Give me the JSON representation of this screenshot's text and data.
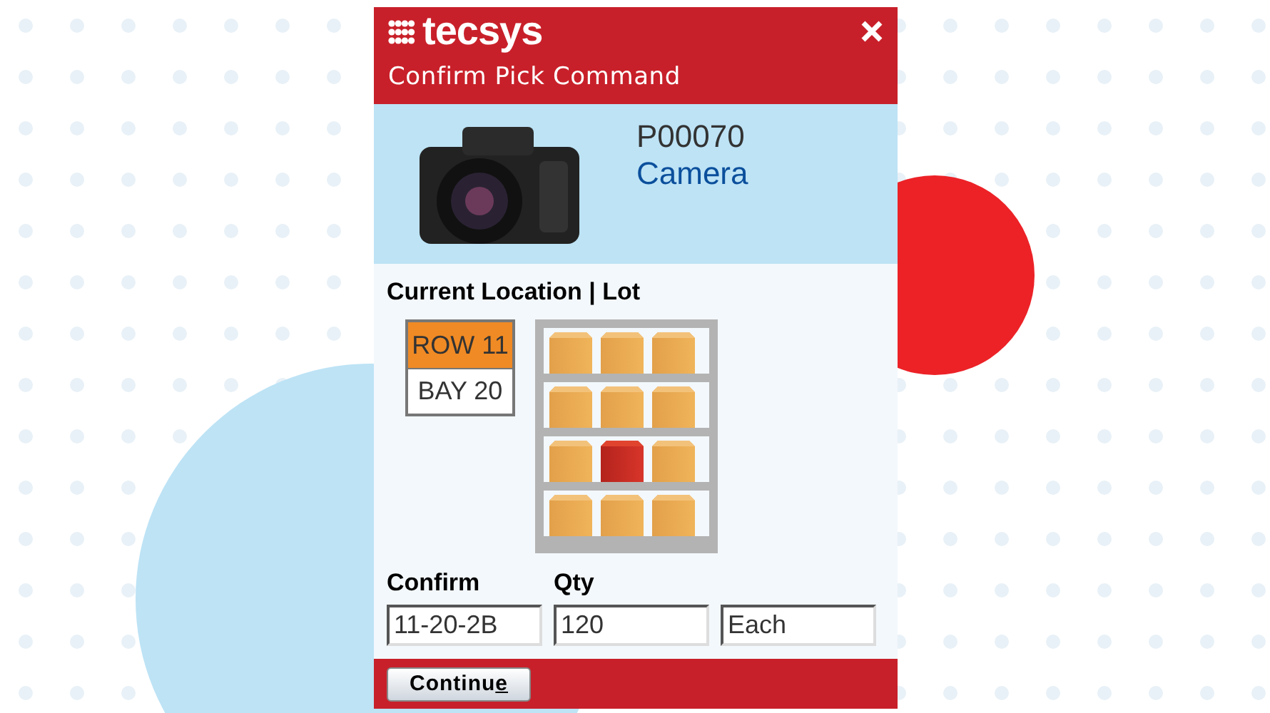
{
  "brand": {
    "name": "tecsys"
  },
  "dialog": {
    "title": "Confirm Pick Command"
  },
  "product": {
    "code": "P00070",
    "name": "Camera"
  },
  "location": {
    "heading": "Current Location | Lot",
    "items": [
      {
        "label": "ROW 11",
        "selected": true
      },
      {
        "label": "BAY 20",
        "selected": false
      }
    ]
  },
  "shelf": {
    "slots": [
      {
        "selected": false
      },
      {
        "selected": false
      },
      {
        "selected": false
      },
      {
        "selected": false
      },
      {
        "selected": false
      },
      {
        "selected": false
      },
      {
        "selected": false
      },
      {
        "selected": true
      },
      {
        "selected": false
      },
      {
        "selected": false
      },
      {
        "selected": false
      },
      {
        "selected": false
      }
    ]
  },
  "form": {
    "labels": [
      "Confirm",
      "Qty"
    ],
    "fields": [
      {
        "value": "11-20-2B"
      },
      {
        "value": "120"
      },
      {
        "value": "Each"
      }
    ]
  },
  "footer": {
    "button": {
      "label_parts": [
        {
          "text": "Continu",
          "underlined": false
        },
        {
          "text": "e",
          "underlined": true
        }
      ]
    }
  }
}
